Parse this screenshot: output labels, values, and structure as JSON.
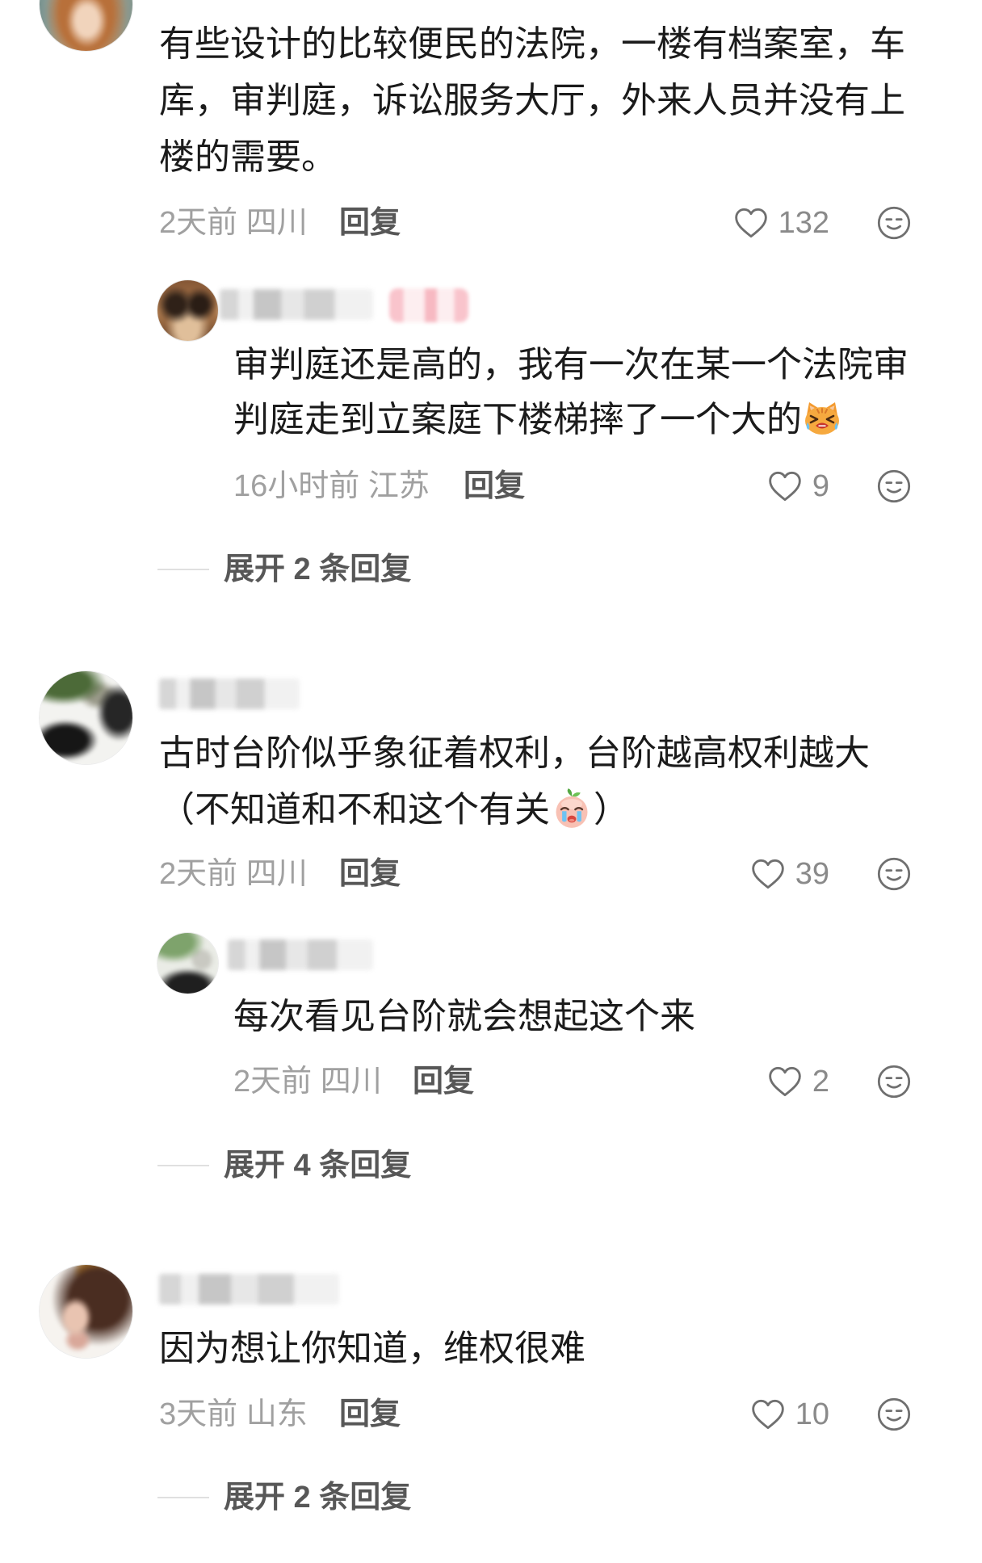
{
  "theme": {
    "background": "#ffffff",
    "text_color": "#1b1b1b",
    "meta_color": "#a0a0a0",
    "reply_color": "#575757",
    "count_color": "#8a8a8a",
    "icon_color": "#6f6f6f",
    "expand_color": "#575757",
    "divider_color": "#e0e0e0"
  },
  "icons": {
    "like": "heart-outline-icon",
    "emoji_picker": "smiley-face-icon"
  },
  "comments": [
    {
      "text_lines": [
        "有些设计的比较便民的法院，一楼有档案室，车",
        "库，审判庭，诉讼服务大厅，外来人员并没有上",
        "楼的需要。"
      ],
      "time_location": "2天前 四川",
      "reply_label": "回复",
      "likes": 132,
      "replies": [
        {
          "text_lines": [
            "审判庭还是高的，我有一次在某一个法院审",
            "判庭走到立案庭下楼梯摔了一个大的"
          ],
          "inline_emoji": "crying-cat-emoji-icon",
          "time_location": "16小时前 江苏",
          "reply_label": "回复",
          "likes": 9
        }
      ],
      "expand_replies": "展开 2 条回复"
    },
    {
      "text_lines": [
        "古时台阶似乎象征着权利，台阶越高权利越大",
        "（不知道和不和这个有关"
      ],
      "inline_emoji": "crying-peach-emoji-icon",
      "text_after_emoji": "）",
      "time_location": "2天前 四川",
      "reply_label": "回复",
      "likes": 39,
      "replies": [
        {
          "text_lines": [
            "每次看见台阶就会想起这个来"
          ],
          "time_location": "2天前 四川",
          "reply_label": "回复",
          "likes": 2
        }
      ],
      "expand_replies": "展开 4 条回复"
    },
    {
      "text_lines": [
        "因为想让你知道，维权很难"
      ],
      "time_location": "3天前 山东",
      "reply_label": "回复",
      "likes": 10,
      "expand_replies": "展开 2 条回复"
    }
  ]
}
